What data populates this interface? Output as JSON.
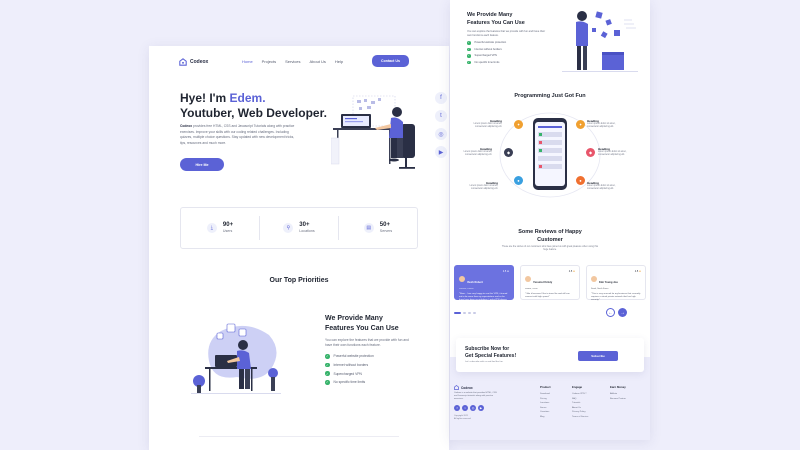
{
  "brand": {
    "name": "Codeox",
    "accent": "#5b62d6",
    "check_color": "#37b36b"
  },
  "nav": {
    "items": [
      "Home",
      "Projects",
      "Services",
      "About Us",
      "Help"
    ],
    "contact_label": "Contact Us"
  },
  "hero": {
    "line1_prefix": "Hye! I'm ",
    "line1_name": "Edem.",
    "line2": "Youtuber, Web Developer.",
    "desc_bold": "Codeox",
    "desc": " provides free HTML, CSS and Javascript Tutorials along with practice exercises. Improve your skills with our coding related challenges. Including quizzes, multiple choice questions. Stay updated with new development tricks, tips, resources and much more.",
    "hire_label": "Hire Me"
  },
  "stats": [
    {
      "icon": "download-icon",
      "value": "90+",
      "label": "Users"
    },
    {
      "icon": "location-icon",
      "value": "30+",
      "label": "Locations"
    },
    {
      "icon": "server-icon",
      "value": "50+",
      "label": "Servers"
    }
  ],
  "priorities": {
    "title": "Our Top Priorities"
  },
  "features": {
    "title_line1": "We Provide Many",
    "title_line2": "Features You Can Use",
    "desc": "You can explore the features that we provide with fun and have their own functions each feature.",
    "items": [
      "Powerful website protection",
      "Internet without borders",
      "Supercharged VPN",
      "No specific time limits"
    ]
  },
  "social": [
    "facebook-icon",
    "twitter-icon",
    "instagram-icon",
    "youtube-icon"
  ],
  "programming": {
    "title": "Programming Just Got Fun",
    "heading": "Heading",
    "text": "Lorem ipsum dolor sit amet, consectetur adipiscing elit."
  },
  "reviews": {
    "title_line1": "Some Reviews of Happy",
    "title_line2": "Customer",
    "subtitle": "These are the stories of our customers who have joined us with great pleasure when using this huge feature.",
    "cards": [
      {
        "name": "Viezh Robert",
        "role": "Warsaw, Poland",
        "rating": "4.5",
        "text": "\"Wow... I am very happy to use this VPN, it turned out to be more than my expectations and so far there have been no problems. LaslesVPN always the best\""
      },
      {
        "name": "Yessica Christy",
        "role": "Shanxi, China",
        "rating": "4.5",
        "text": "\"I like it because I like to travel far and still can connect with high speed.\""
      },
      {
        "name": "Kim Young Jou",
        "role": "Seoul, South Korea",
        "rating": "4.5",
        "text": "\"This is very unusual for my business that currently requires a virtual private network that has high security.\""
      }
    ]
  },
  "subscribe": {
    "title_line1": "Subscribe Now for",
    "title_line2": "Get Special Features!",
    "desc": "Let's subscribe with us and find the fun.",
    "button": "Subscribe"
  },
  "footer": {
    "brand": "Codeox",
    "desc": "Codeox is a website that provides HTML, CSS and Javascript tutorials along with practice exercises.",
    "copy1": "Copyright 2021",
    "copy2": "All rights reserved",
    "columns": [
      {
        "title": "Product",
        "items": [
          "Download",
          "Pricing",
          "Locations",
          "Server",
          "Countries",
          "Blog"
        ]
      },
      {
        "title": "Engage",
        "items": [
          "Codeox VPN ?",
          "FAQ",
          "Tutorials",
          "About Us",
          "Privacy Policy",
          "Terms of Service"
        ]
      },
      {
        "title": "Earn Money",
        "items": [
          "Affiliate",
          "Become Partner"
        ]
      }
    ]
  }
}
